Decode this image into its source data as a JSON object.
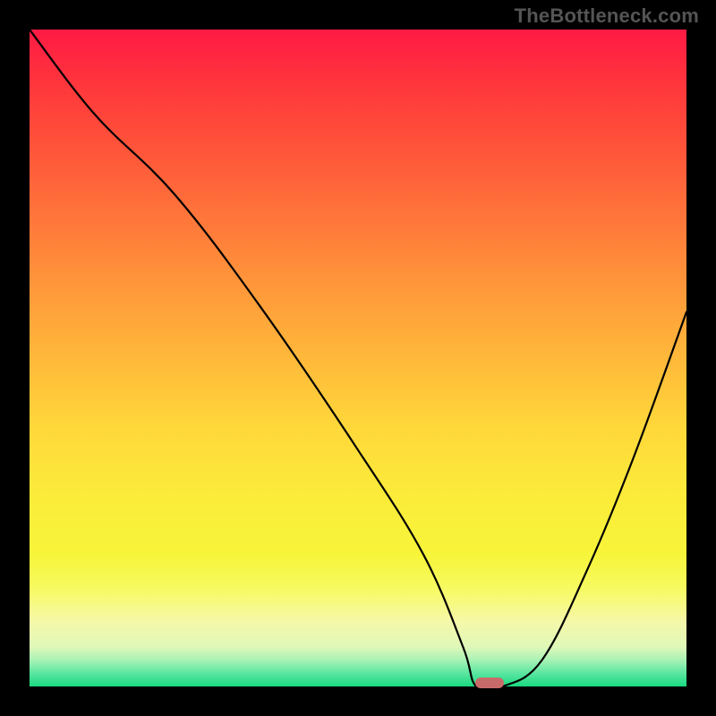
{
  "watermark": "TheBottleneck.com",
  "chart_data": {
    "type": "line",
    "title": "",
    "xlabel": "",
    "ylabel": "",
    "xlim": [
      0,
      100
    ],
    "ylim": [
      0,
      100
    ],
    "series": [
      {
        "name": "curve",
        "x": [
          0,
          10,
          22,
          35,
          50,
          60,
          66,
          68,
          72,
          78,
          85,
          92,
          100
        ],
        "y": [
          100,
          87,
          75,
          58,
          36,
          20,
          6,
          0,
          0,
          4,
          18,
          35,
          57
        ]
      }
    ],
    "marker": {
      "x": 70,
      "y": 0,
      "color": "#c96a6a"
    },
    "gradient_stops": [
      {
        "pos": 0.0,
        "color": "#ff1a44"
      },
      {
        "pos": 0.5,
        "color": "#ffb83a"
      },
      {
        "pos": 0.8,
        "color": "#f7f53a"
      },
      {
        "pos": 1.0,
        "color": "#19d97f"
      }
    ]
  }
}
